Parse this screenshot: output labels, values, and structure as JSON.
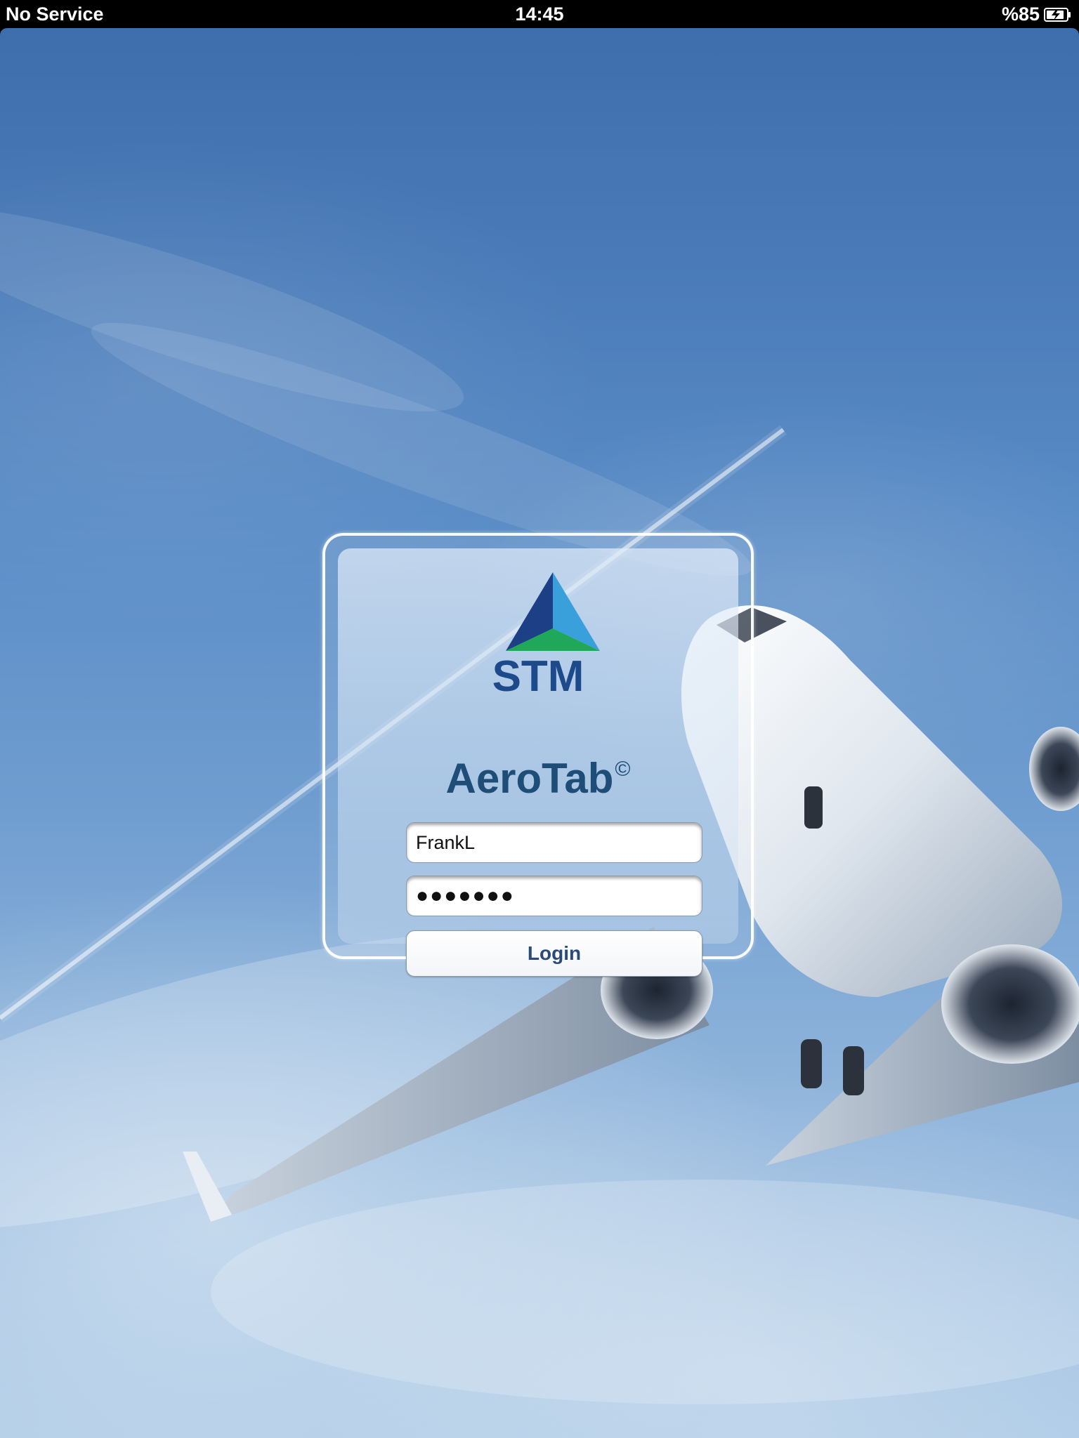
{
  "status_bar": {
    "carrier": "No Service",
    "time": "14:45",
    "battery_text": "%85",
    "battery_icon": "battery-charging-icon"
  },
  "branding": {
    "logo_text": "STM",
    "logo_colors": {
      "dark_blue": "#1d3f86",
      "light_blue": "#3aa0dc",
      "green": "#1fa85a"
    }
  },
  "app": {
    "title": "AeroTab",
    "copyright_mark": "©"
  },
  "login_form": {
    "username_value": "FrankL",
    "password_value": "●●●●●●●",
    "login_label": "Login"
  }
}
